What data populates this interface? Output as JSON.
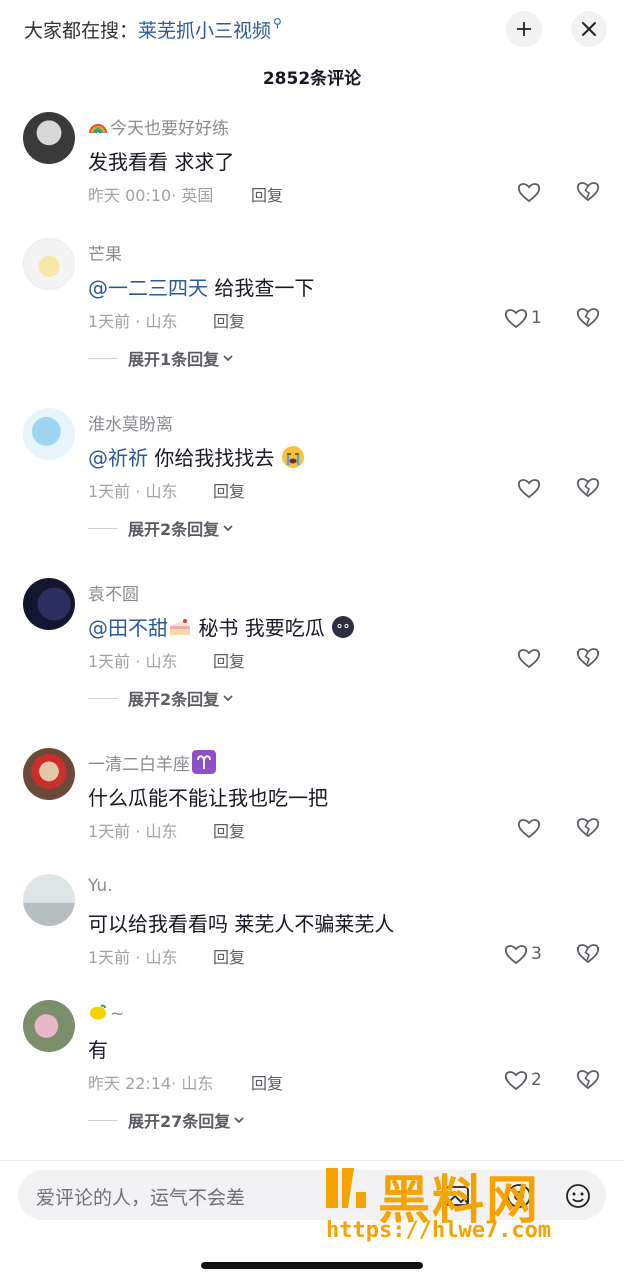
{
  "search_hint": {
    "prefix": "大家都在搜：",
    "keyword": "莱芜抓小三视频"
  },
  "header": {
    "comment_count": "2852条评论"
  },
  "comments": [
    {
      "user": "今天也要好好练",
      "text_plain": "发我看看 求求了",
      "time": "昨天 00:10",
      "location": "· 英国",
      "reply": "回复",
      "likes": "",
      "expand": ""
    },
    {
      "user": "芒果",
      "mention": "@一二三四天",
      "text_plain": " 给我查一下",
      "time": "1天前",
      "location": "· 山东",
      "reply": "回复",
      "likes": "1",
      "expand": "展开1条回复"
    },
    {
      "user": "淮水莫盼离",
      "mention": "@祈祈",
      "text_plain": " 你给我找找去",
      "time": "1天前",
      "location": "· 山东",
      "reply": "回复",
      "likes": "",
      "expand": "展开2条回复"
    },
    {
      "user": "袁不圆",
      "mention": "@田不甜",
      "text_plain": " 秘书 我要吃瓜",
      "time": "1天前",
      "location": "· 山东",
      "reply": "回复",
      "likes": "",
      "expand": "展开2条回复"
    },
    {
      "user": "一清二白羊座",
      "text_plain": "什么瓜能不能让我也吃一把",
      "time": "1天前",
      "location": "· 山东",
      "reply": "回复",
      "likes": "",
      "expand": ""
    },
    {
      "user": "Yu.",
      "text_plain": "可以给我看看吗 莱芜人不骗莱芜人",
      "time": "1天前",
      "location": "· 山东",
      "reply": "回复",
      "likes": "3",
      "expand": ""
    },
    {
      "user": "~",
      "text_plain": "有",
      "time": "昨天 22:14",
      "location": "· 山东",
      "reply": "回复",
      "likes": "2",
      "expand": "展开27条回复"
    }
  ],
  "input": {
    "placeholder": "爱评论的人，运气不会差"
  },
  "watermark": {
    "text": "黑料网",
    "url": "https://hlwe7.com"
  },
  "colors": {
    "mention": "#2b5a94",
    "accent_watermark": "#f5a300",
    "muted": "#8a8b91"
  }
}
